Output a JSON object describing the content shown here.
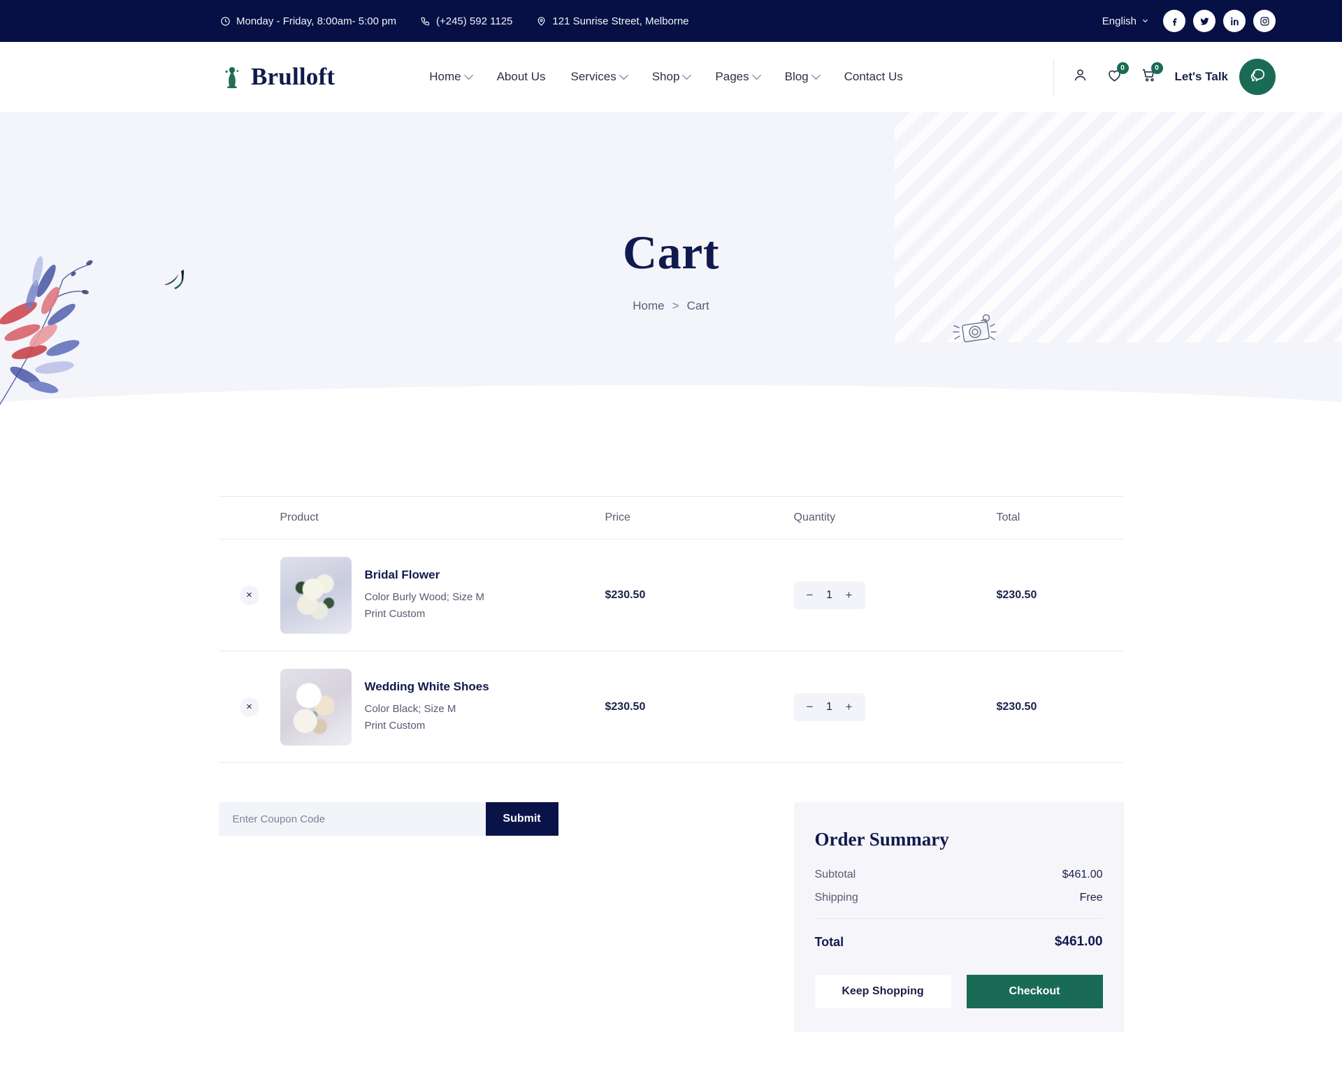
{
  "topbar": {
    "hours": "Monday - Friday, 8:00am- 5:00 pm",
    "phone": "(+245) 592 1125",
    "address": "121 Sunrise Street, Melborne",
    "language": "English",
    "socials": [
      {
        "name": "facebook-icon",
        "label": "Facebook"
      },
      {
        "name": "twitter-icon",
        "label": "Twitter"
      },
      {
        "name": "linkedin-icon",
        "label": "LinkedIn"
      },
      {
        "name": "instagram-icon",
        "label": "Instagram"
      }
    ]
  },
  "header": {
    "brand": "Brulloft",
    "nav": [
      {
        "label": "Home",
        "has_caret": true
      },
      {
        "label": "About Us",
        "has_caret": false
      },
      {
        "label": "Services",
        "has_caret": true
      },
      {
        "label": "Shop",
        "has_caret": true
      },
      {
        "label": "Pages",
        "has_caret": true
      },
      {
        "label": "Blog",
        "has_caret": true
      },
      {
        "label": "Contact Us",
        "has_caret": false
      }
    ],
    "wishlist_count": "0",
    "cart_count": "0",
    "lets_talk": "Let's Talk"
  },
  "hero": {
    "title": "Cart",
    "breadcrumb_home": "Home",
    "breadcrumb_sep": ">",
    "breadcrumb_current": "Cart"
  },
  "cart": {
    "columns": {
      "product": "Product",
      "price": "Price",
      "quantity": "Quantity",
      "total": "Total"
    },
    "items": [
      {
        "name": "Bridal Flower",
        "variant": "Color Burly Wood; Size M",
        "print": "Print Custom",
        "price": "$230.50",
        "quantity": "1",
        "total": "$230.50",
        "remove_label": "×"
      },
      {
        "name": "Wedding White Shoes",
        "variant": "Color Black; Size M",
        "print": "Print Custom",
        "price": "$230.50",
        "quantity": "1",
        "total": "$230.50",
        "remove_label": "×"
      }
    ],
    "qty_minus": "−",
    "qty_plus": "+"
  },
  "coupon": {
    "placeholder": "Enter Coupon Code",
    "value": "",
    "submit_label": "Submit"
  },
  "summary": {
    "title": "Order Summary",
    "subtotal_label": "Subtotal",
    "subtotal_value": "$461.00",
    "shipping_label": "Shipping",
    "shipping_value": "Free",
    "total_label": "Total",
    "total_value": "$461.00",
    "keep_shopping_label": "Keep Shopping",
    "checkout_label": "Checkout"
  },
  "colors": {
    "navy": "#061045",
    "green": "#1a6b55",
    "hero_bg": "#f4f4fb",
    "panel_bg": "#f6f6fa"
  }
}
